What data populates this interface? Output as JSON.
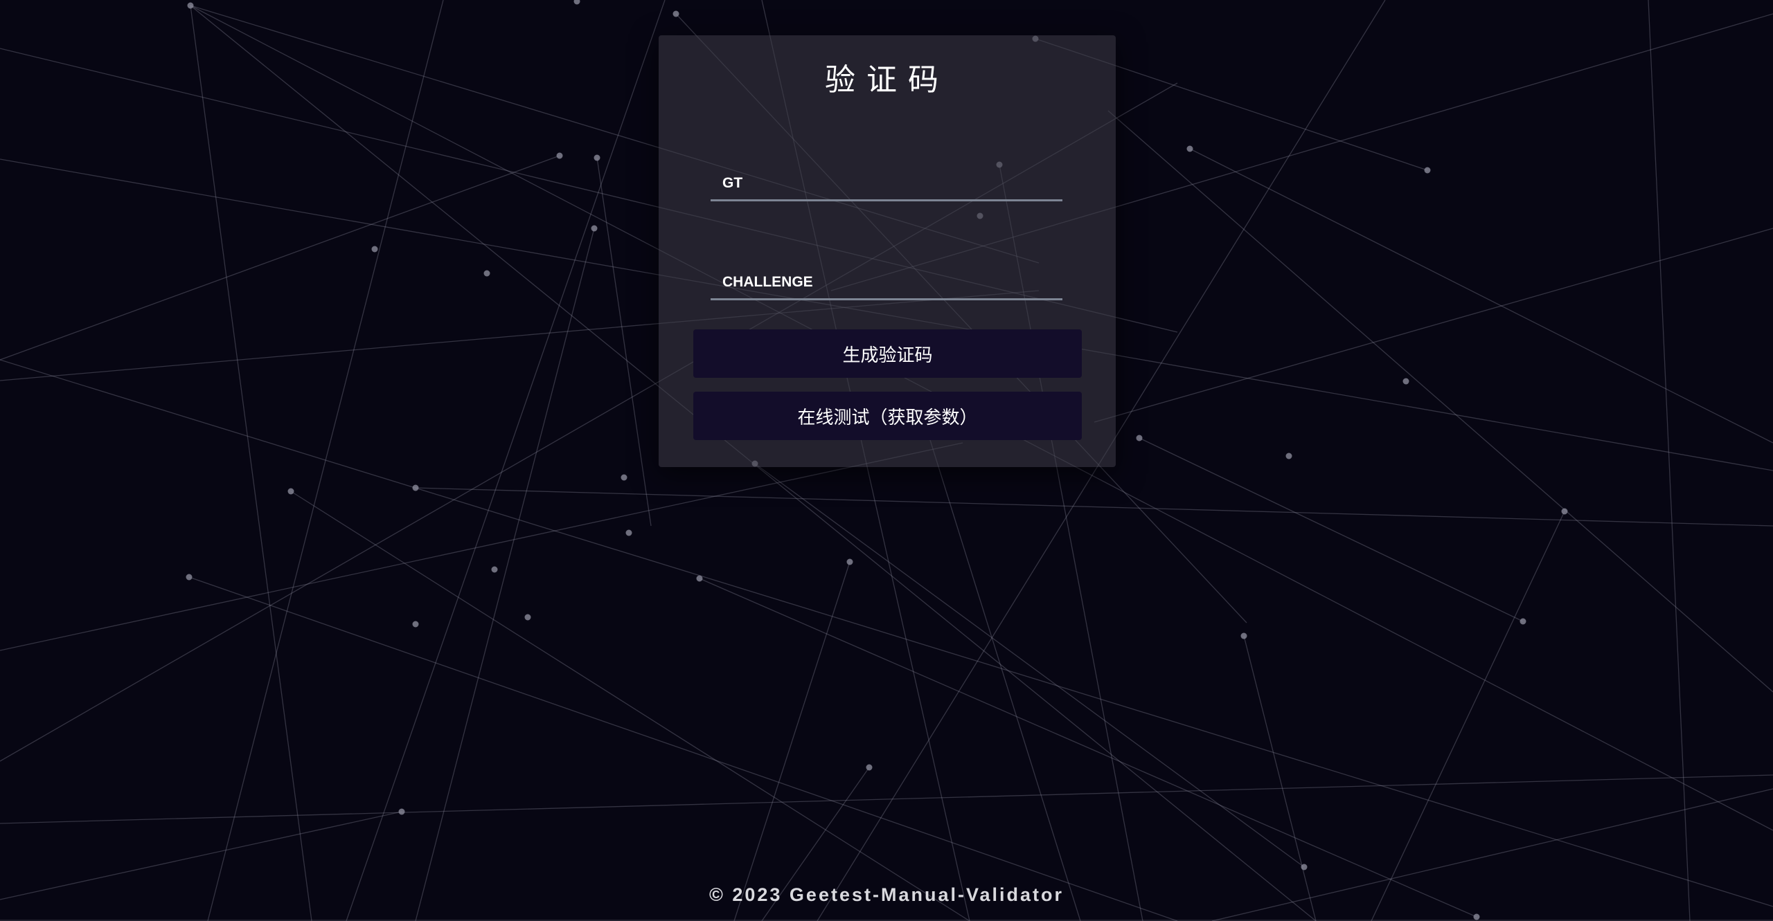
{
  "panel": {
    "title": "验证码",
    "gt_label": "GT",
    "gt_value": "",
    "challenge_label": "CHALLENGE",
    "challenge_value": "",
    "generate_button": "生成验证码",
    "test_button": "在线测试（获取参数）"
  },
  "footer": {
    "text": "© 2023 Geetest-Manual-Validator"
  },
  "colors": {
    "background": "#070613",
    "panel": "#3c3a46",
    "button": "#130d2a",
    "input_underline": "#7d8594",
    "network_lines": "#8a8a9a"
  }
}
